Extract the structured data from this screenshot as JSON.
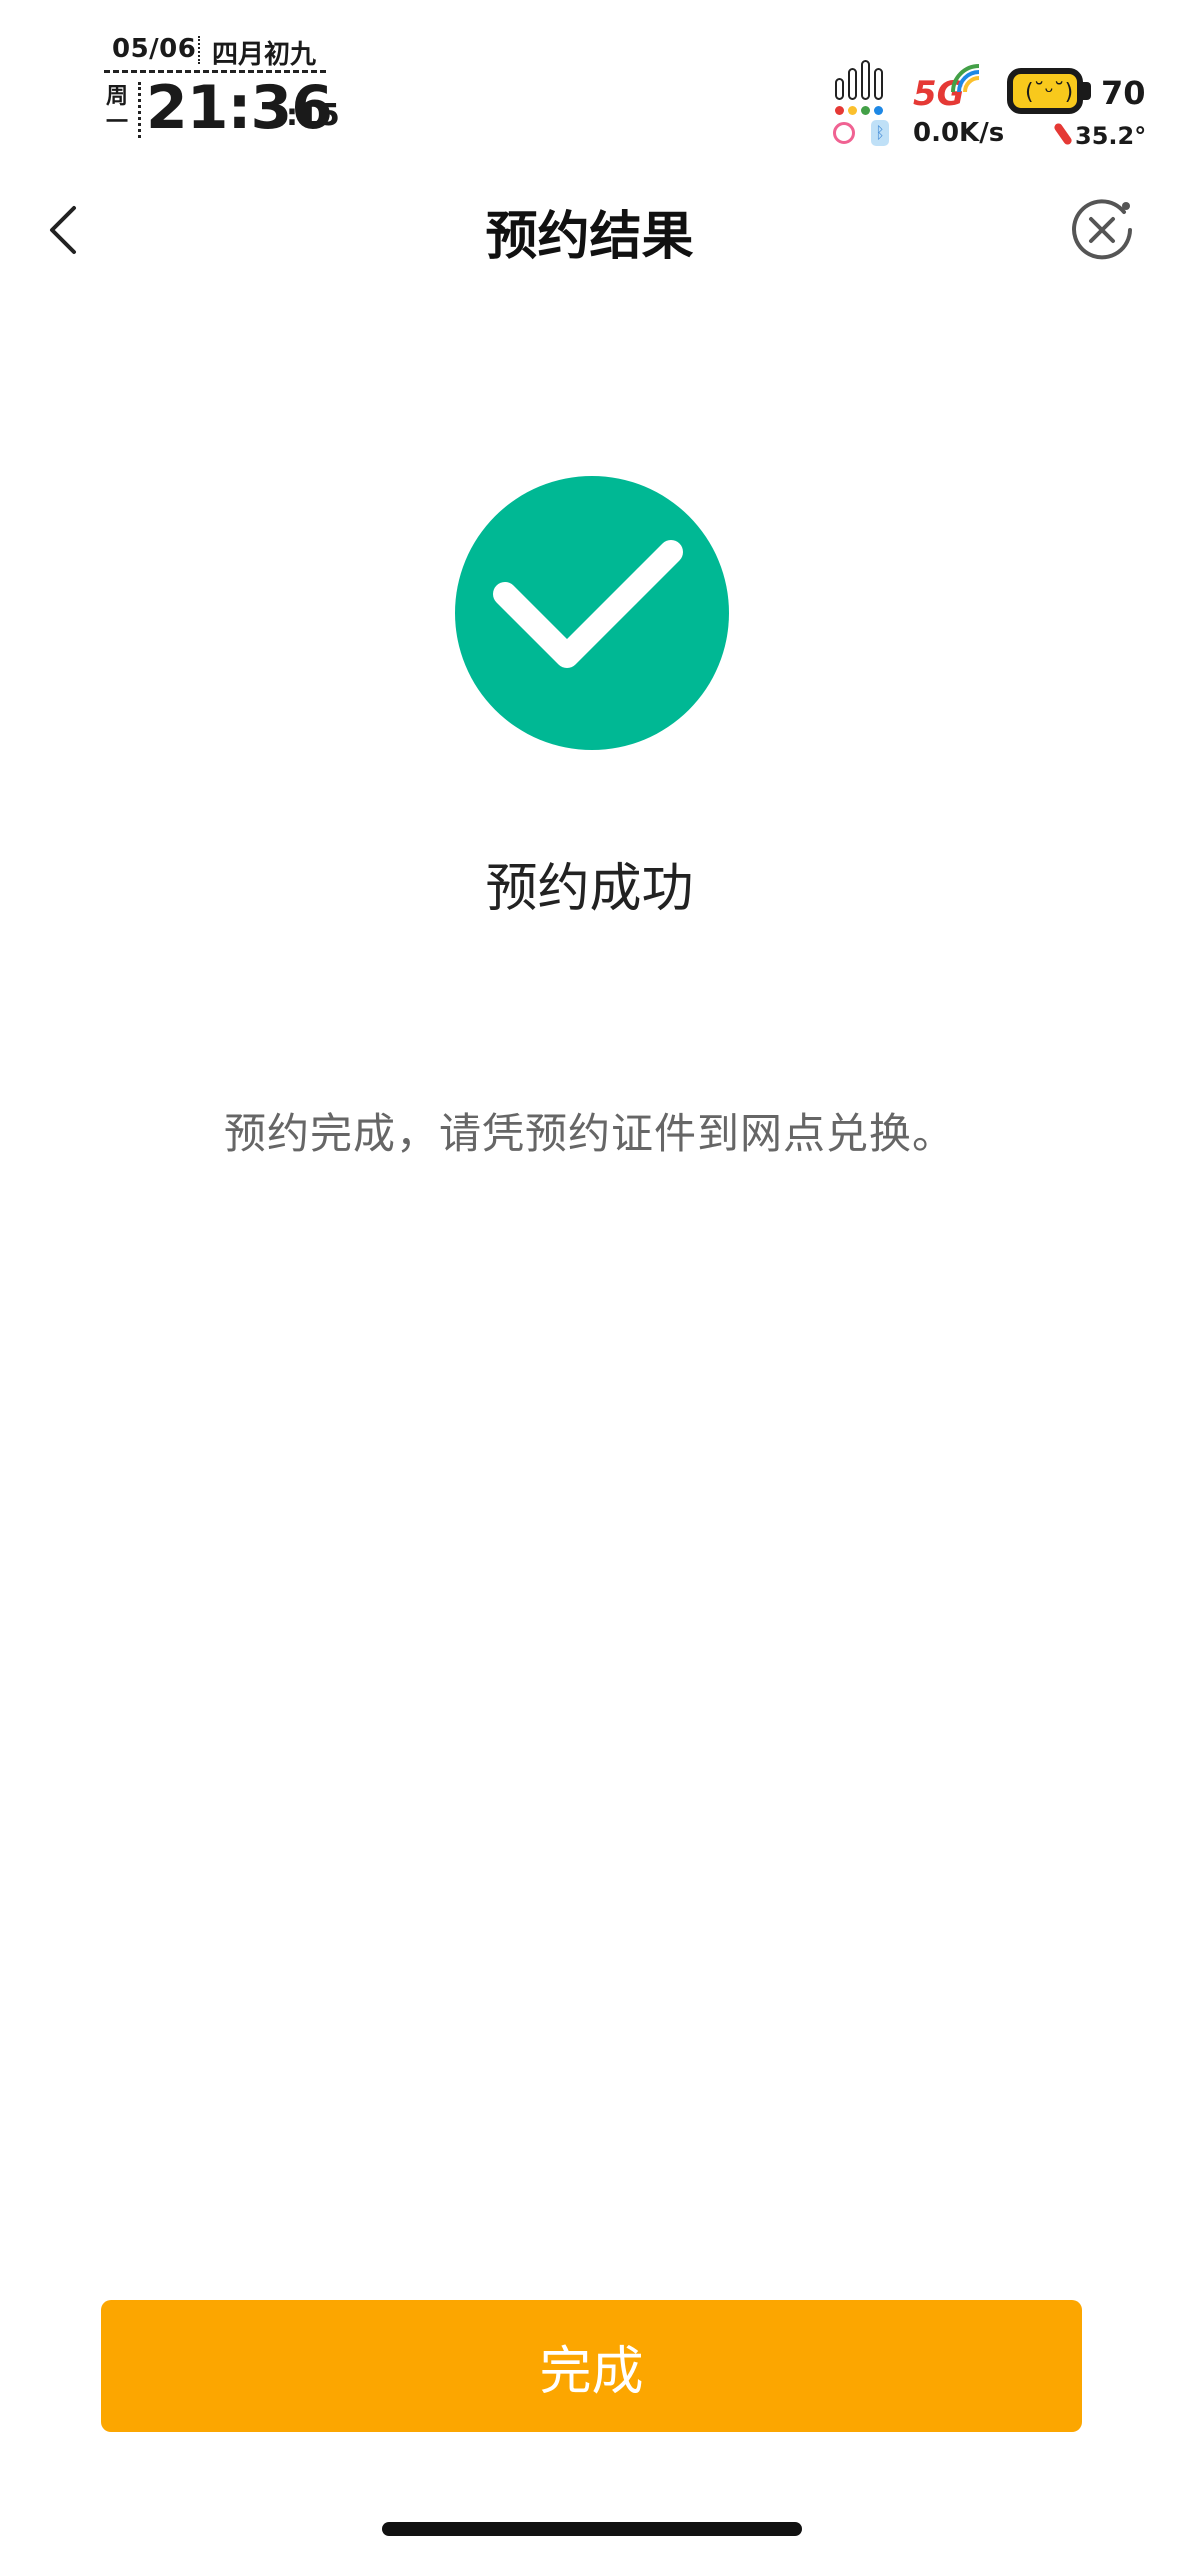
{
  "status_bar": {
    "date": "05/06",
    "lunar_date": "四月初九",
    "weekday_line1": "周",
    "weekday_line2": "一",
    "time": "21:36",
    "seconds": ":15",
    "network": "5G",
    "net_speed": "0.0K/s",
    "battery_level": "70",
    "temperature": "35.2°",
    "battery_face": "(˘ᵕ˘)",
    "icons": [
      "signal-icon",
      "5g-icon",
      "battery-icon",
      "ring-icon",
      "bluetooth-icon",
      "thermometer-icon"
    ]
  },
  "nav": {
    "title": "预约结果",
    "back_icon": "chevron-left-icon",
    "close_icon": "close-circle-icon"
  },
  "result": {
    "icon": "check-circle-icon",
    "icon_color": "#00b894",
    "title": "预约成功",
    "description": "预约完成，请凭预约证件到网点兑换。"
  },
  "footer": {
    "done_label": "完成",
    "button_color": "#fca600"
  }
}
